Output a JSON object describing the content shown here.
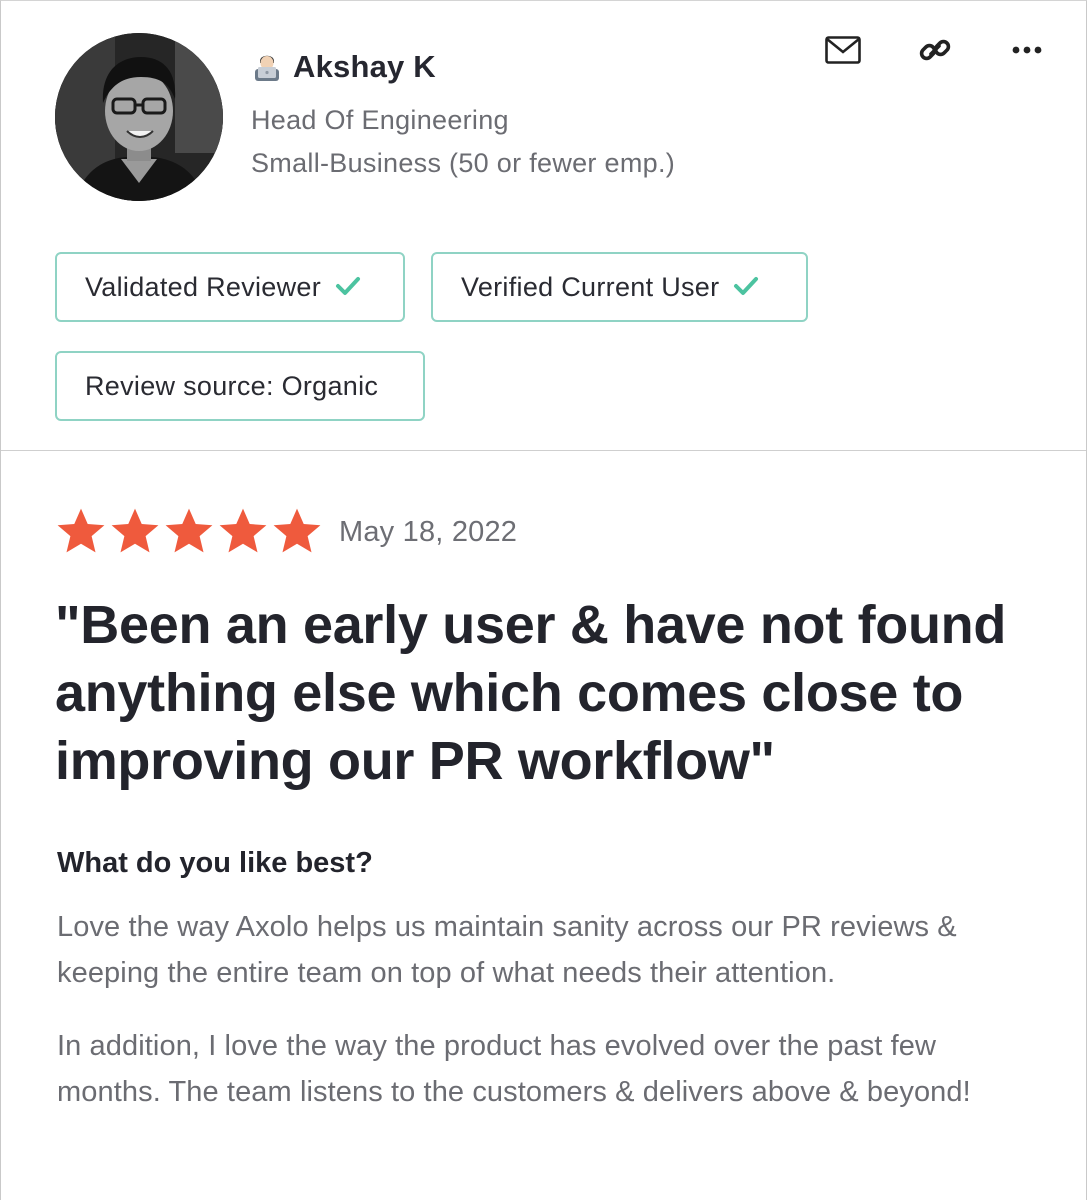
{
  "reviewer": {
    "name": "Akshay K",
    "emoji_icon": "technologist-emoji-icon",
    "role": "Head Of Engineering",
    "company_size": "Small-Business (50 or fewer emp.)"
  },
  "actions": {
    "email_icon": "envelope-icon",
    "link_icon": "link-icon",
    "more_icon": "more-dots-icon"
  },
  "badges": {
    "validated": "Validated Reviewer",
    "verified": "Verified Current User",
    "source": "Review source: Organic"
  },
  "review": {
    "rating": 5,
    "max_rating": 5,
    "date": "May 18, 2022",
    "title": "\"Been an early user & have not found anything else which comes close to improving our PR workflow\"",
    "question": "What do you like best?",
    "answer_p1": "Love the way Axolo helps us maintain sanity across our PR reviews & keeping the entire team on top of what needs their attention.",
    "answer_p2": "In addition, I love the way the product has evolved over the past few months. The team listens to the customers & delivers above & beyond!"
  },
  "colors": {
    "star": "#ef5a3d",
    "badge_border": "#8fd3c4",
    "check": "#4cc3a0",
    "text_dark": "#23242c",
    "text_muted": "#6b6c72"
  }
}
